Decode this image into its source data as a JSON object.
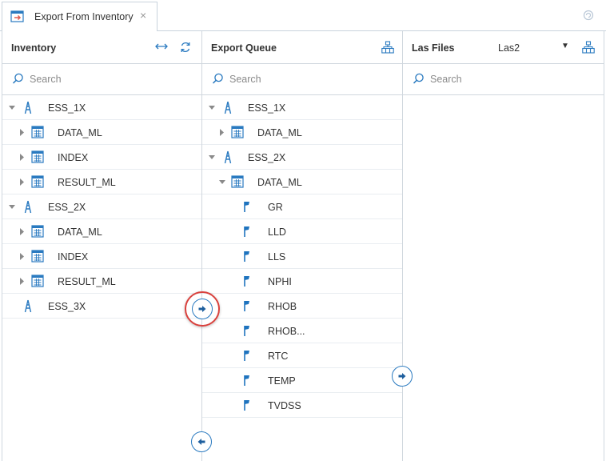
{
  "tab": {
    "title": "Export From Inventory",
    "close": "×"
  },
  "inventory": {
    "title": "Inventory",
    "search_placeholder": "Search",
    "wells": [
      {
        "name": "ESS_1X",
        "items": [
          "DATA_ML",
          "INDEX",
          "RESULT_ML"
        ]
      },
      {
        "name": "ESS_2X",
        "items": [
          "DATA_ML",
          "INDEX",
          "RESULT_ML"
        ]
      },
      {
        "name": "ESS_3X",
        "items": []
      }
    ]
  },
  "queue": {
    "title": "Export Queue",
    "search_placeholder": "Search",
    "wells": [
      {
        "name": "ESS_1X",
        "dataset": "DATA_ML",
        "expanded": false,
        "curves": []
      },
      {
        "name": "ESS_2X",
        "dataset": "DATA_ML",
        "expanded": true,
        "curves": [
          "GR",
          "LLD",
          "LLS",
          "NPHI",
          "RHOB",
          "RHOB...",
          "RTC",
          "TEMP",
          "TVDSS"
        ]
      }
    ]
  },
  "las": {
    "title": "Las Files",
    "selected": "Las2",
    "search_placeholder": "Search"
  },
  "colors": {
    "accent": "#2a7ac0",
    "highlight": "#d9413d",
    "border": "#d0d7de"
  }
}
